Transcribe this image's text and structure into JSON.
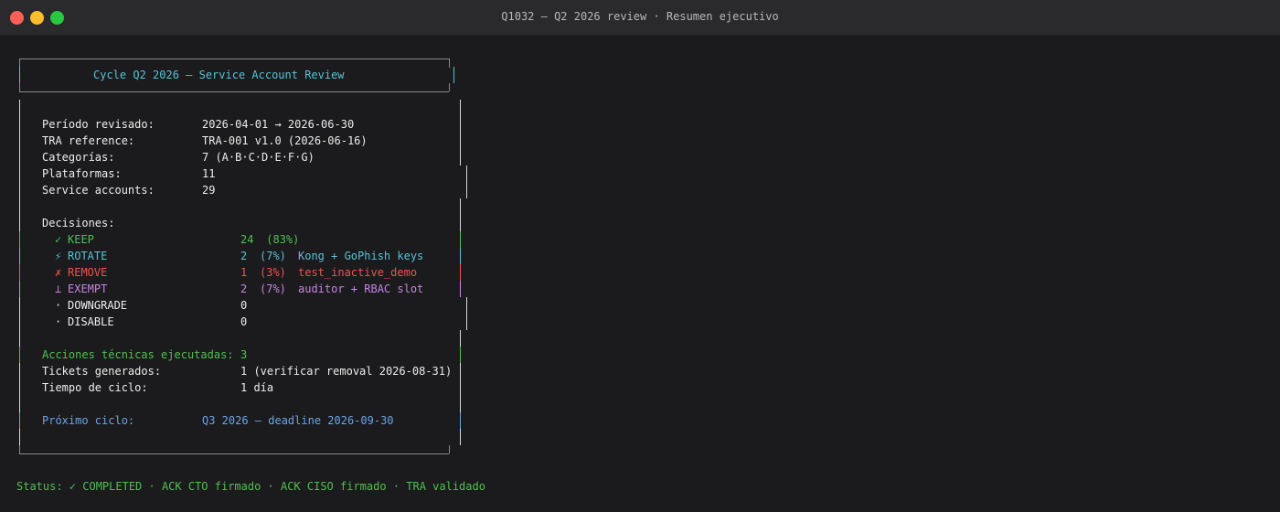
{
  "window": {
    "title": "Q1032 — Q2 2026 review · Resumen ejecutivo"
  },
  "box": {
    "title": "Cycle Q2 2026 — Service Account Review",
    "fields": [
      {
        "label": "Período revisado:",
        "value": "2026‑04‑01 → 2026‑06‑30"
      },
      {
        "label": "TRA reference:",
        "value": "TRA‑001 v1.0 (2026‑06‑16)"
      },
      {
        "label": "Categorías:",
        "value": "7 (A·B·C·D·E·F·G)"
      },
      {
        "label": "Plataformas:",
        "value": "11"
      },
      {
        "label": "Service accounts:",
        "value": "29"
      }
    ],
    "decisions_label": "Decisiones:",
    "decisions": [
      {
        "icon": "✓",
        "name": "KEEP",
        "count": "24",
        "pct": " (83%)",
        "note": "",
        "color": "#4fc04f"
      },
      {
        "icon": "⚡",
        "name": "ROTATE",
        "count": "2",
        "pct": "(7%)",
        "note": "Kong + GoPhish keys",
        "color": "#56c2d6"
      },
      {
        "icon": "✗",
        "name": "REMOVE",
        "count": "1",
        "pct": "(3%)",
        "note": "test_inactive_demo",
        "color": "#f0524f"
      },
      {
        "icon": "⊥",
        "name": "EXEMPT",
        "count": "2",
        "pct": "(7%)",
        "note": "auditor + RBAC slot",
        "color": "#c586e0"
      },
      {
        "icon": "·",
        "name": "DOWNGRADE",
        "count": "0",
        "pct": "",
        "note": "",
        "color": "#ececec"
      },
      {
        "icon": "·",
        "name": "DISABLE",
        "count": "0",
        "pct": "",
        "note": "",
        "color": "#ececec"
      }
    ],
    "actions": {
      "label": "Acciones técnicas ejecutadas:",
      "value": "3"
    },
    "tickets": {
      "label": "Tickets generados:",
      "value": "1 (verificar removal 2026‑08‑31)"
    },
    "cycle_time": {
      "label": "Tiempo de ciclo:",
      "value": "1 día"
    },
    "next_cycle": {
      "label": "Próximo ciclo:",
      "value": "Q3 2026 — deadline 2026‑09‑30"
    }
  },
  "status_line": "Status: ✓ COMPLETED · ACK CTO firmado · ACK CISO firmado · TRA validado",
  "colors": {
    "background": "#1b1b1d",
    "titlebar": "#2a2a2c",
    "keep": "#4fc04f",
    "rotate": "#56c2d6",
    "remove": "#f0524f",
    "exempt": "#c586e0",
    "next_cycle": "#6ba4e6"
  }
}
